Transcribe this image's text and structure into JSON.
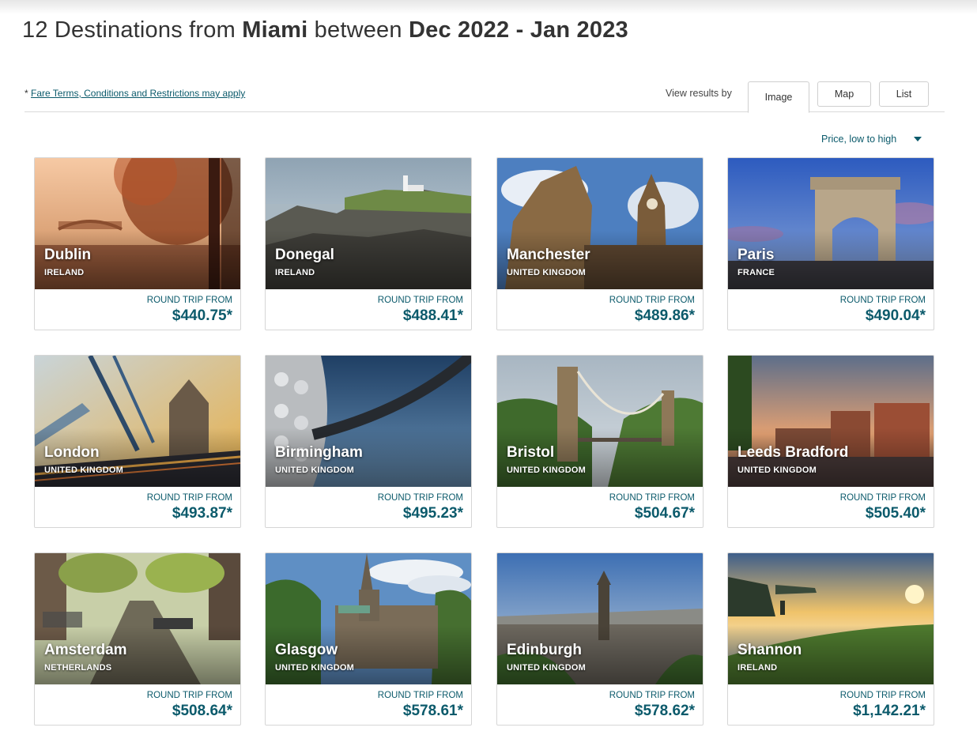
{
  "header": {
    "prefix": "12 Destinations from ",
    "origin": "Miami",
    "between": " between ",
    "dates": "Dec 2022 - Jan 2023"
  },
  "toolbar": {
    "fare_prefix": "* ",
    "fare_link": "Fare Terms, Conditions and Restrictions may apply",
    "view_label": "View results by",
    "views": [
      "Image",
      "Map",
      "List"
    ],
    "active_view": "Image"
  },
  "sort": {
    "label": "Price, low to high"
  },
  "colors": {
    "accent": "#0b5a6b"
  },
  "destinations": [
    {
      "city": "Dublin",
      "country": "IRELAND",
      "label": "ROUND TRIP FROM",
      "price": "$440.75*"
    },
    {
      "city": "Donegal",
      "country": "IRELAND",
      "label": "ROUND TRIP FROM",
      "price": "$488.41*"
    },
    {
      "city": "Manchester",
      "country": "UNITED KINGDOM",
      "label": "ROUND TRIP FROM",
      "price": "$489.86*"
    },
    {
      "city": "Paris",
      "country": "FRANCE",
      "label": "ROUND TRIP FROM",
      "price": "$490.04*"
    },
    {
      "city": "London",
      "country": "UNITED KINGDOM",
      "label": "ROUND TRIP FROM",
      "price": "$493.87*"
    },
    {
      "city": "Birmingham",
      "country": "UNITED KINGDOM",
      "label": "ROUND TRIP FROM",
      "price": "$495.23*"
    },
    {
      "city": "Bristol",
      "country": "UNITED KINGDOM",
      "label": "ROUND TRIP FROM",
      "price": "$504.67*"
    },
    {
      "city": "Leeds Bradford",
      "country": "UNITED KINGDOM",
      "label": "ROUND TRIP FROM",
      "price": "$505.40*"
    },
    {
      "city": "Amsterdam",
      "country": "NETHERLANDS",
      "label": "ROUND TRIP FROM",
      "price": "$508.64*"
    },
    {
      "city": "Glasgow",
      "country": "UNITED KINGDOM",
      "label": "ROUND TRIP FROM",
      "price": "$578.61*"
    },
    {
      "city": "Edinburgh",
      "country": "UNITED KINGDOM",
      "label": "ROUND TRIP FROM",
      "price": "$578.62*"
    },
    {
      "city": "Shannon",
      "country": "IRELAND",
      "label": "ROUND TRIP FROM",
      "price": "$1,142.21*"
    }
  ]
}
